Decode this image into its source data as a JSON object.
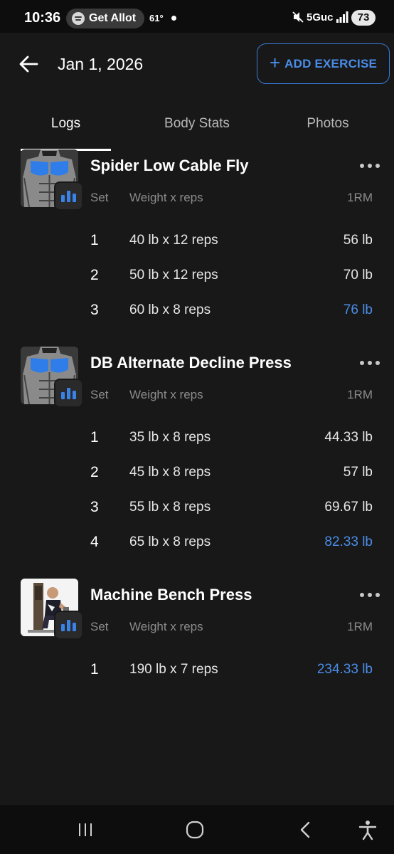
{
  "status_bar": {
    "time": "10:36",
    "media_pill": "Get Allot",
    "temperature": "61°",
    "network": "5Guc",
    "battery": "73"
  },
  "header": {
    "date": "Jan 1, 2026",
    "add_button_label": "ADD EXERCISE"
  },
  "tabs": [
    {
      "label": "Logs",
      "active": true
    },
    {
      "label": "Body Stats",
      "active": false
    },
    {
      "label": "Photos",
      "active": false
    }
  ],
  "columns": {
    "set": "Set",
    "weight_reps": "Weight x reps",
    "one_rm": "1RM"
  },
  "exercises": [
    {
      "name": "Spider Low Cable Fly",
      "thumbnail": "chest-muscle-diagram",
      "sets": [
        {
          "set": "1",
          "weight_reps": "40 lb x 12 reps",
          "one_rm": "56 lb",
          "highlight": false
        },
        {
          "set": "2",
          "weight_reps": "50 lb x 12 reps",
          "one_rm": "70 lb",
          "highlight": false
        },
        {
          "set": "3",
          "weight_reps": "60 lb x 8 reps",
          "one_rm": "76 lb",
          "highlight": true
        }
      ]
    },
    {
      "name": "DB Alternate Decline Press",
      "thumbnail": "chest-muscle-diagram",
      "sets": [
        {
          "set": "1",
          "weight_reps": "35 lb x 8 reps",
          "one_rm": "44.33 lb",
          "highlight": false
        },
        {
          "set": "2",
          "weight_reps": "45 lb x 8 reps",
          "one_rm": "57 lb",
          "highlight": false
        },
        {
          "set": "3",
          "weight_reps": "55 lb x 8 reps",
          "one_rm": "69.67 lb",
          "highlight": false
        },
        {
          "set": "4",
          "weight_reps": "65 lb x 8 reps",
          "one_rm": "82.33 lb",
          "highlight": true
        }
      ]
    },
    {
      "name": "Machine Bench Press",
      "thumbnail": "exercise-photo",
      "sets": [
        {
          "set": "1",
          "weight_reps": "190 lb x 7 reps",
          "one_rm": "234.33 lb",
          "highlight": true
        }
      ]
    }
  ],
  "colors": {
    "background": "#181818",
    "accent": "#4a8de8",
    "muted_text": "#8c8c8c"
  },
  "icons": {
    "back": "arrow-left-icon",
    "add": "plus-icon",
    "menu": "more-horizontal-icon",
    "chart": "bar-chart-icon",
    "nav_recents": "recents-icon",
    "nav_home": "home-icon",
    "nav_back": "chevron-left-icon",
    "nav_accessibility": "accessibility-icon"
  }
}
